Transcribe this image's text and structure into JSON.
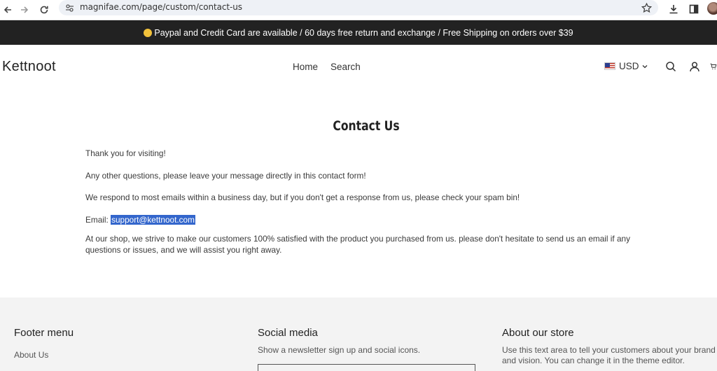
{
  "browser": {
    "url": "magnifae.com/page/custom/contact-us"
  },
  "announcement": {
    "text": "Paypal and Credit Card are available / 60 days free return and exchange / Free Shipping on orders over $39"
  },
  "header": {
    "logo": "Kettnoot",
    "nav": [
      {
        "label": "Home"
      },
      {
        "label": "Search"
      }
    ],
    "currency": "USD"
  },
  "main": {
    "title": "Contact Us",
    "paragraph_1": "Thank you for visiting!",
    "paragraph_2": "Any other questions, please leave your message directly in this contact form!",
    "paragraph_3": "We respond to most emails within a business day, but if you don't get a response from us, please check your spam bin!",
    "email_label": "Email: ",
    "email": "support@kettnoot.com",
    "paragraph_5": "At our shop, we strive to make our customers 100% satisfied with the product you purchased from us. please don't hesitate to send us an email if any questions or issues, and we will assist you right away."
  },
  "footer": {
    "menu_title": "Footer menu",
    "menu_items": [
      {
        "label": "About Us"
      }
    ],
    "social_title": "Social media",
    "social_text": "Show a newsletter sign up and social icons.",
    "about_title": "About our store",
    "about_text": "Use this text area to tell your customers about your brand and vision. You can change it in the theme editor."
  }
}
